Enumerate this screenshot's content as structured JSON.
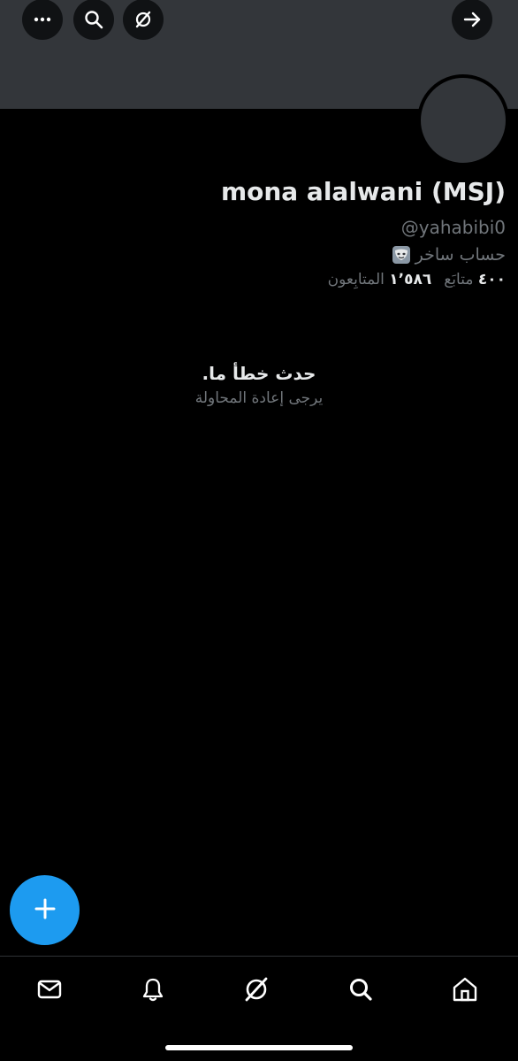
{
  "header": {
    "buttons": [
      {
        "icon": "more-icon"
      },
      {
        "icon": "search-icon"
      },
      {
        "icon": "grok-icon"
      },
      {
        "icon": "back-arrow-icon"
      }
    ]
  },
  "profile": {
    "display_name": "mona alalwani (MSJ)",
    "handle": "@yahabibi0",
    "parody_label": "حساب ساخر",
    "parody_icon": "mask-icon",
    "following_count": "٤٠٠",
    "following_label": "متابَع",
    "followers_count": "١٬٥٨٦",
    "followers_label": "المتابِعون"
  },
  "error": {
    "title": "حدث خطأ ما.",
    "subtitle": "يرجى إعادة المحاولة"
  },
  "fab": {
    "icon": "plus-icon"
  },
  "bottom_nav": {
    "items": [
      {
        "icon": "messages-icon"
      },
      {
        "icon": "notifications-icon"
      },
      {
        "icon": "grok-icon"
      },
      {
        "icon": "search-icon"
      },
      {
        "icon": "home-icon"
      }
    ]
  },
  "colors": {
    "background": "#000000",
    "banner": "#33363a",
    "accent": "#1d9bf0",
    "text_primary": "#e7e9ea",
    "text_secondary": "#71767b"
  }
}
